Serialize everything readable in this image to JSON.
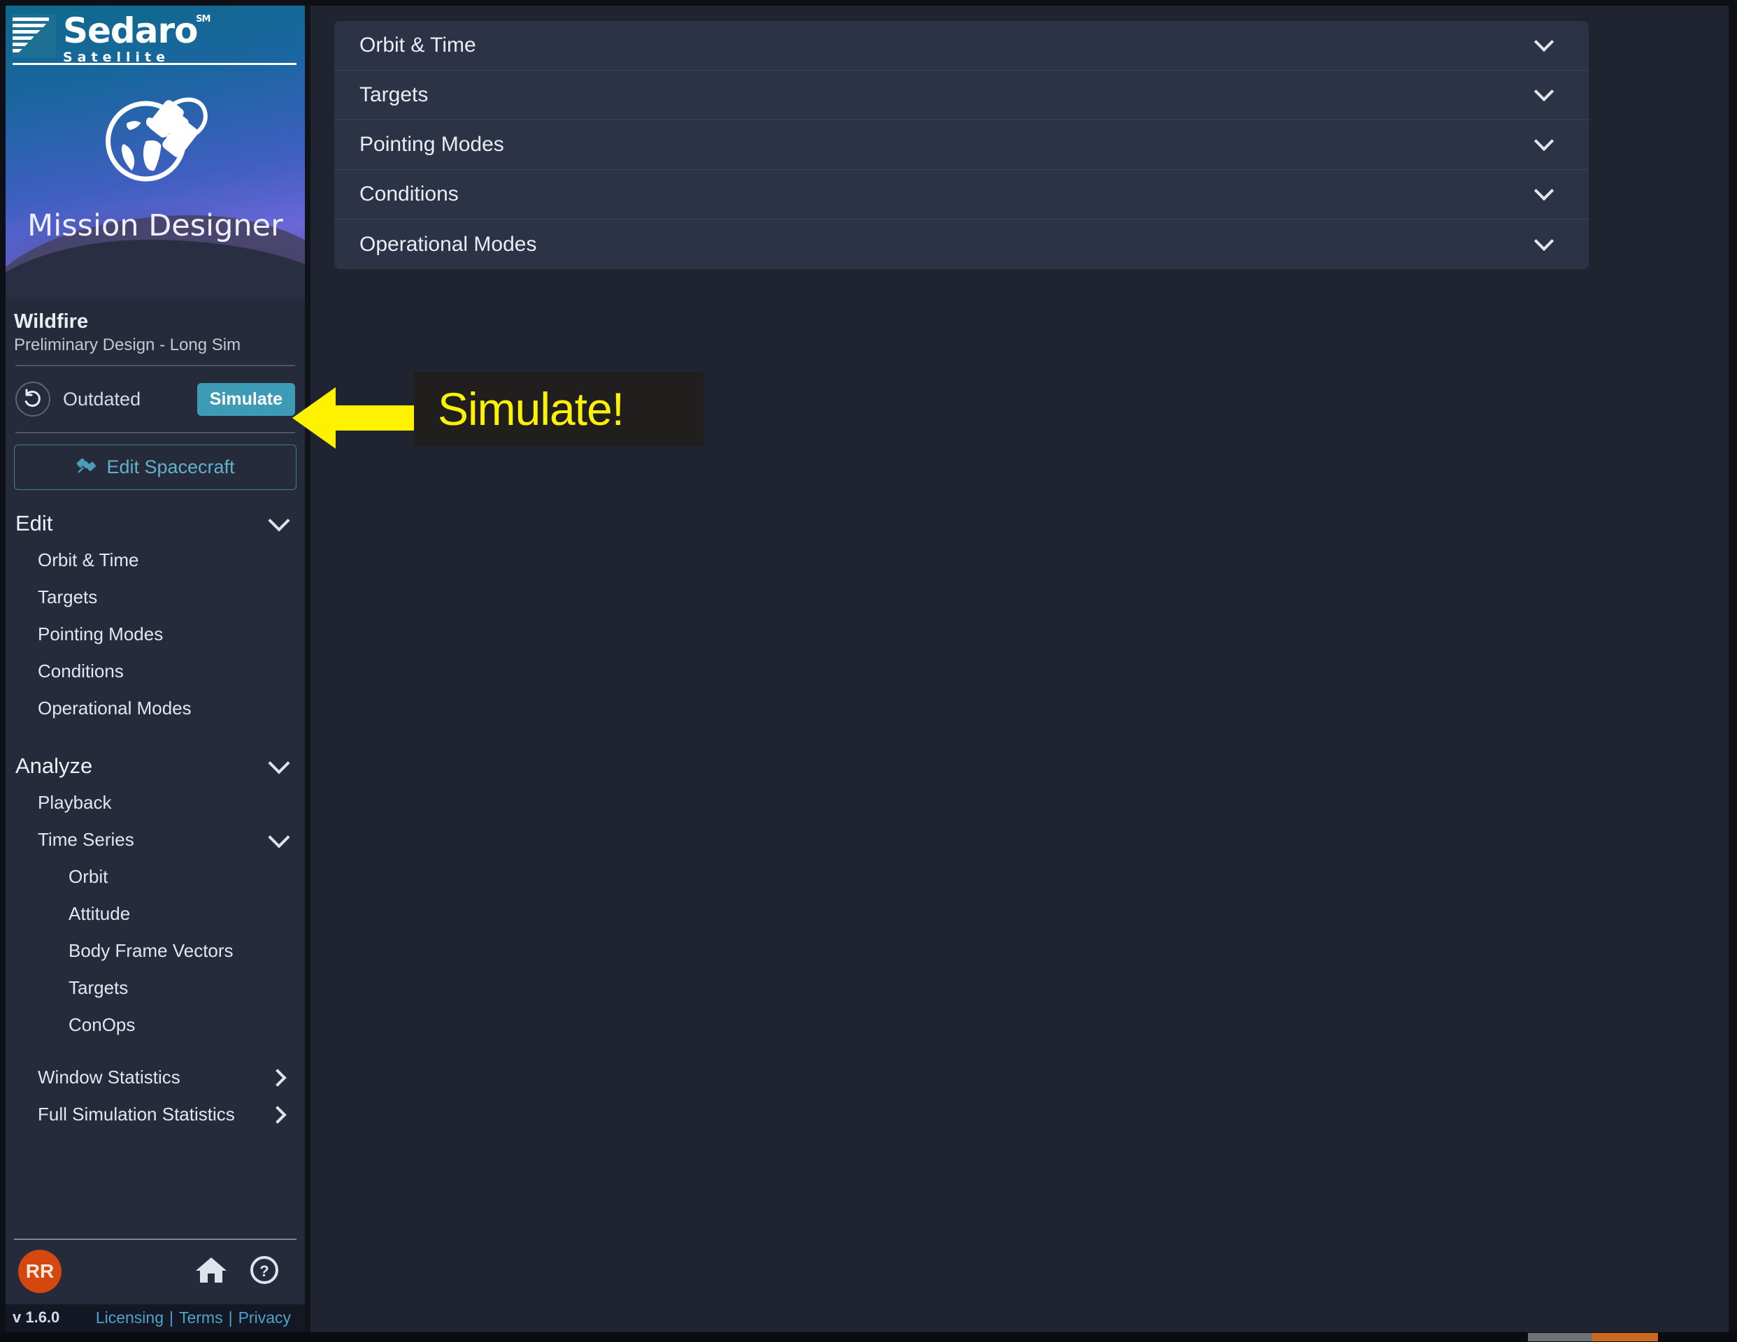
{
  "brand": {
    "logo_name": "Sedaro",
    "logo_sm": "SM",
    "logo_sub": "Satellite",
    "logo_mark_icon": "sedaro-stripes-logo-icon",
    "globe_icon": "globe-satellite-icon",
    "app_title": "Mission Designer"
  },
  "project": {
    "name": "Wildfire",
    "subtitle": "Preliminary Design - Long Sim",
    "status_icon": "refresh-history-icon",
    "status_label": "Outdated",
    "simulate_label": "Simulate",
    "edit_spacecraft_label": "Edit Spacecraft",
    "edit_spacecraft_icon": "satellite-icon"
  },
  "sidebar": {
    "groups": [
      {
        "label": "Edit",
        "icon": "chevron-down-icon",
        "items": [
          {
            "label": "Orbit & Time"
          },
          {
            "label": "Targets"
          },
          {
            "label": "Pointing Modes"
          },
          {
            "label": "Conditions"
          },
          {
            "label": "Operational Modes"
          }
        ]
      },
      {
        "label": "Analyze",
        "icon": "chevron-down-icon",
        "items": [
          {
            "label": "Playback"
          },
          {
            "label": "Time Series",
            "icon": "chevron-down-icon",
            "children": [
              {
                "label": "Orbit"
              },
              {
                "label": "Attitude"
              },
              {
                "label": "Body Frame Vectors"
              },
              {
                "label": "Targets"
              },
              {
                "label": "ConOps"
              }
            ]
          },
          {
            "label": "Window Statistics",
            "icon": "chevron-right-icon"
          },
          {
            "label": "Full Simulation Statistics",
            "icon": "chevron-right-icon"
          }
        ]
      }
    ]
  },
  "footer": {
    "avatar_initials": "RR",
    "home_icon": "home-icon",
    "help_icon": "help-circle-icon",
    "version": "v 1.6.0",
    "links": [
      {
        "label": "Licensing"
      },
      {
        "label": "Terms"
      },
      {
        "label": "Privacy"
      }
    ],
    "link_separator": "|"
  },
  "main": {
    "accordion": [
      {
        "label": "Orbit & Time",
        "icon": "chevron-down-icon"
      },
      {
        "label": "Targets",
        "icon": "chevron-down-icon"
      },
      {
        "label": "Pointing Modes",
        "icon": "chevron-down-icon"
      },
      {
        "label": "Conditions",
        "icon": "chevron-down-icon"
      },
      {
        "label": "Operational Modes",
        "icon": "chevron-down-icon"
      }
    ]
  },
  "annotation": {
    "text": "Simulate!",
    "arrow_icon": "left-arrow-annotation-icon",
    "arrow_color": "#fff200",
    "text_color": "#fff200",
    "box_color": "#211f1e"
  },
  "taskbar": {
    "segments": [
      {
        "color": "#6d7076"
      },
      {
        "color": "#cb6a1e"
      }
    ]
  },
  "colors": {
    "accent_teal": "#3e9bb5",
    "sidebar_bg": "#262b3b",
    "main_bg": "#1f2430",
    "panel_bg": "#2d3346",
    "avatar_bg": "#d4470f"
  }
}
